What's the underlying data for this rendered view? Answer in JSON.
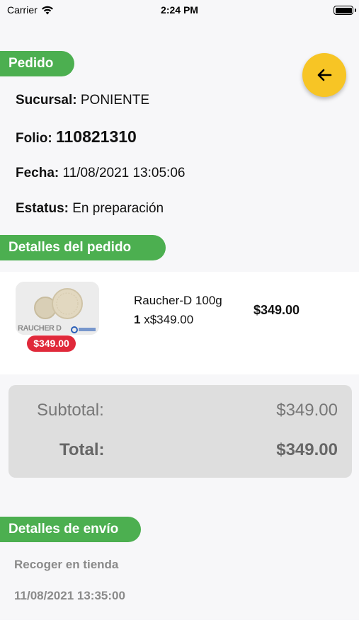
{
  "status_bar": {
    "carrier": "Carrier",
    "time": "2:24 PM"
  },
  "order": {
    "section_title": "Pedido",
    "branch_label": "Sucursal:",
    "branch_value": "PONIENTE",
    "folio_label": "Folio:",
    "folio_value": "110821310",
    "date_label": "Fecha:",
    "date_value": "11/08/2021 13:05:06",
    "status_label": "Estatus:",
    "status_value": "En preparación"
  },
  "details": {
    "section_title": "Detalles del pedido",
    "items": [
      {
        "image_text": "RAUCHER D",
        "price_badge": "$349.00",
        "name": "Raucher-D 100g",
        "quantity": "1",
        "unit_price": "x$349.00",
        "line_total": "$349.00"
      }
    ]
  },
  "totals": {
    "subtotal_label": "Subtotal:",
    "subtotal_value": "$349.00",
    "total_label": "Total:",
    "total_value": "$349.00"
  },
  "shipping": {
    "section_title": "Detalles de envío",
    "method": "Recoger en tienda",
    "datetime": "11/08/2021 13:35:00"
  },
  "icons": {
    "back": "arrow-left-icon",
    "wifi": "wifi-icon",
    "battery": "battery-icon"
  },
  "colors": {
    "section_green": "#4caf50",
    "fab_yellow": "#f7c525",
    "badge_red": "#e0293a"
  }
}
